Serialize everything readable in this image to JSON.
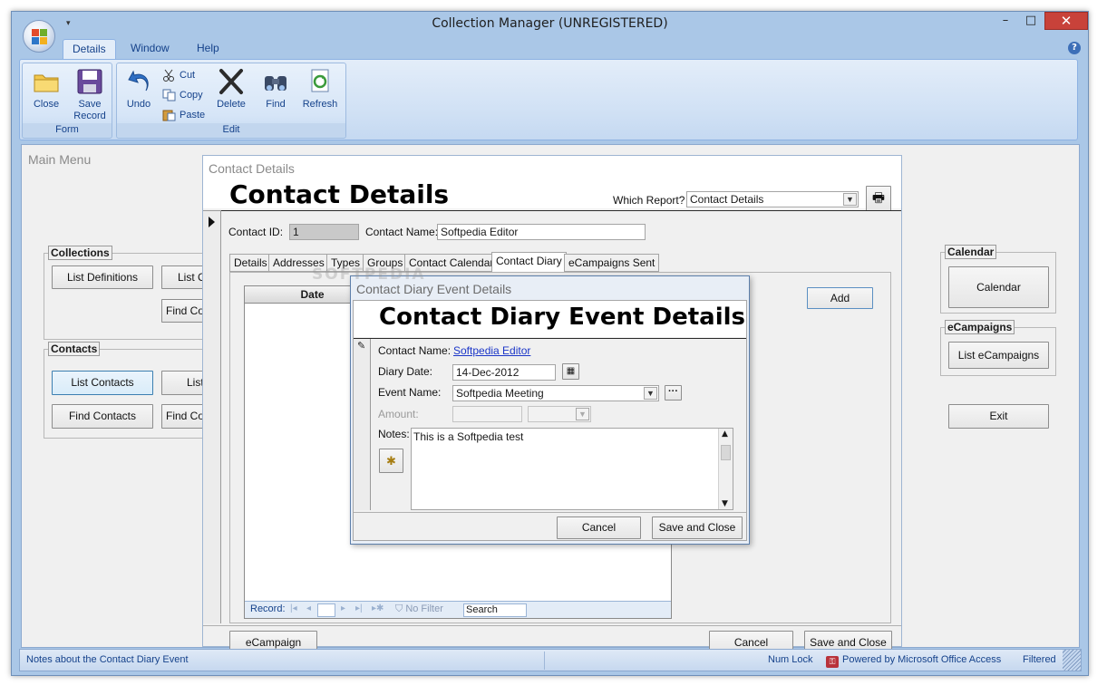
{
  "app": {
    "title": "Collection Manager (UNREGISTERED)"
  },
  "ribbon": {
    "tabs": [
      "Details",
      "Window",
      "Help"
    ],
    "groups": {
      "form": "Form",
      "edit": "Edit"
    },
    "buttons": {
      "close": "Close",
      "save": [
        "Save",
        "Record"
      ],
      "undo": "Undo",
      "cut": "Cut",
      "copy": "Copy",
      "paste": "Paste",
      "delete": "Delete",
      "find": "Find",
      "refresh": "Refresh"
    }
  },
  "main_menu": {
    "title": "Main Menu",
    "collections": {
      "title": "Collections",
      "list_definitions": "List Definitions",
      "list_partial": "List C",
      "find_partial": "Find Col"
    },
    "contacts": {
      "title": "Contacts",
      "list_contacts": "List Contacts",
      "list_partial": "List",
      "find_contacts": "Find Contacts",
      "find_partial": "Find Co"
    },
    "calendar": {
      "title": "Calendar",
      "button": "Calendar"
    },
    "ecampaigns": {
      "title": "eCampaigns",
      "button": "List eCampaigns"
    },
    "exit": "Exit"
  },
  "contact_details": {
    "window_title": "Contact Details",
    "heading": "Contact Details",
    "which_report_label": "Which Report?",
    "which_report_value": "Contact Details",
    "contact_id_label": "Contact ID:",
    "contact_id_value": "1",
    "contact_name_label": "Contact Name:",
    "contact_name_value": "Softpedia Editor",
    "tabs": [
      "Details",
      "Addresses",
      "Types",
      "Groups",
      "Contact Calendar",
      "Contact Diary",
      "eCampaigns Sent"
    ],
    "grid_header_date": "Date",
    "add_button": "Add",
    "record_nav": {
      "label": "Record:",
      "filter": "No Filter",
      "search": "Search"
    },
    "ecampaign_button": "eCampaign",
    "cancel_button": "Cancel",
    "save_close_button": "Save and Close"
  },
  "diary_dialog": {
    "window_title": "Contact Diary Event Details",
    "heading": "Contact Diary Event Details",
    "contact_name_label": "Contact Name:",
    "contact_name_value": "Softpedia Editor",
    "diary_date_label": "Diary Date:",
    "diary_date_value": "14-Dec-2012",
    "event_name_label": "Event Name:",
    "event_name_value": "Softpedia Meeting",
    "amount_label": "Amount:",
    "notes_label": "Notes:",
    "notes_value": "This is a Softpedia test",
    "cancel_button": "Cancel",
    "save_close_button": "Save and Close"
  },
  "statusbar": {
    "message": "Notes about the Contact Diary Event",
    "num_lock": "Num Lock",
    "powered_by": "Powered by Microsoft Office Access",
    "filtered": "Filtered"
  },
  "watermark": "SOFTPEDIA"
}
